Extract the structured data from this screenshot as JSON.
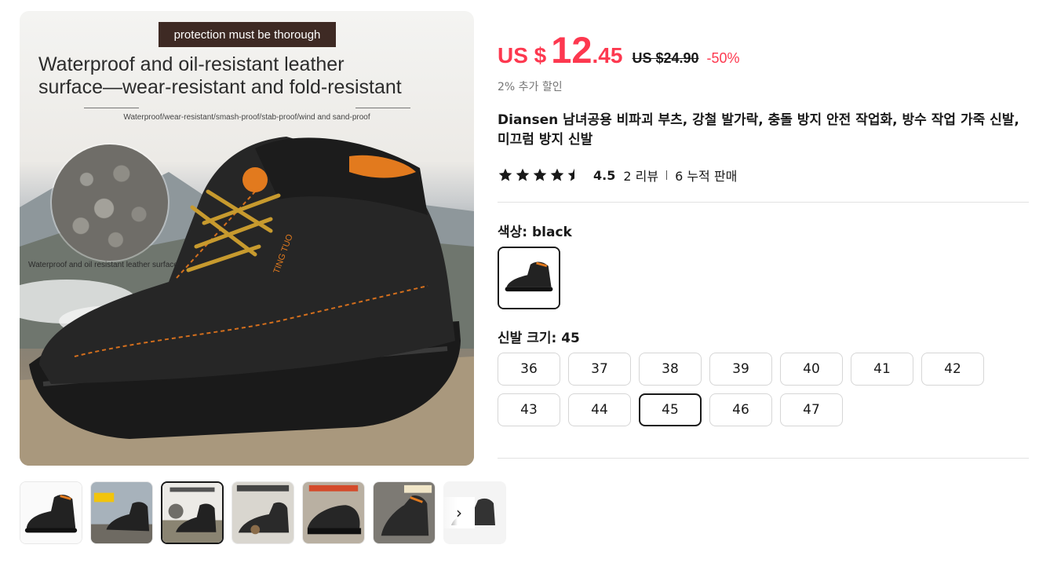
{
  "gallery": {
    "banner": "protection must be thorough",
    "headline_line1": "Waterproof and oil-resistant leather",
    "headline_line2": "surface—wear-resistant and fold-resistant",
    "subline": "Waterproof/wear-resistant/smash-proof/stab-proof/wind and sand-proof",
    "texture_label": "Waterproof and oil resistant leather surface",
    "boot_brand_text": "TING TUO",
    "thumbnail_count": 7,
    "active_thumbnail_index": 2,
    "thumbnails": [
      {
        "caption": ""
      },
      {
        "caption": ""
      },
      {
        "caption": "Waterproof and oil resistant leather surface—wear-resistant and fold-resistant"
      },
      {
        "caption": "Standard steel headsteel bottom"
      },
      {
        "caption": "Wear-resistant non-slip rubber sole"
      },
      {
        "caption": "Tongue design"
      },
      {
        "caption": ""
      }
    ],
    "next_icon": "chevron-right-icon"
  },
  "price": {
    "currency": "US $",
    "integer": "12",
    "decimal": ".45",
    "original": "US $24.90",
    "discount": "-50%",
    "color": "#fd384f"
  },
  "extra_discount": "2% 추가 할인",
  "title": "Diansen 남녀공용 비파괴 부츠, 강철 발가락, 충돌 방지 안전 작업화, 방수 작업 가죽 신발, 미끄럼 방지 신발",
  "rating": {
    "stars": 4.5,
    "score": "4.5",
    "reviews": "2 리뷰",
    "sold": "6 누적 판매"
  },
  "color_option": {
    "label": "색상: ",
    "value": "black"
  },
  "size_option": {
    "label": "신발 크기: ",
    "value": "45",
    "options": [
      "36",
      "37",
      "38",
      "39",
      "40",
      "41",
      "42",
      "43",
      "44",
      "45",
      "46",
      "47"
    ],
    "selected": "45"
  }
}
